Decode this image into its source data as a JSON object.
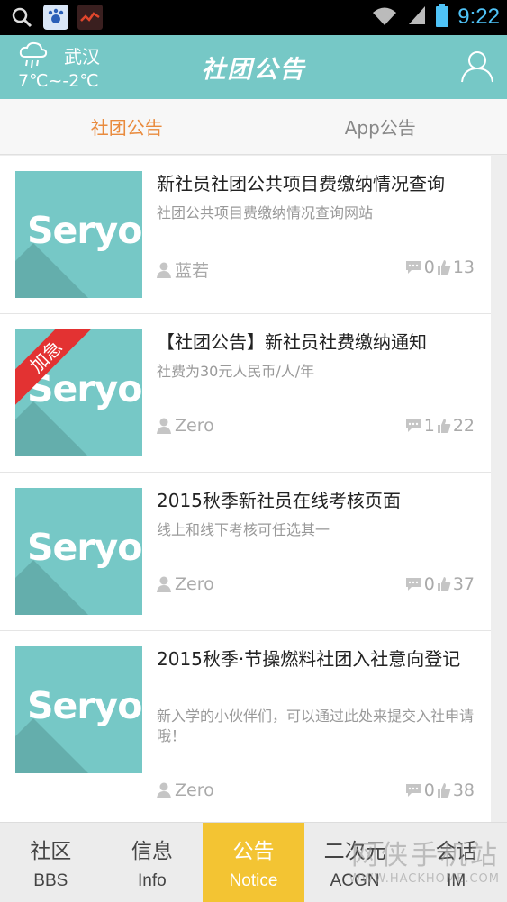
{
  "status_bar": {
    "time": "9:22"
  },
  "header": {
    "city": "武汉",
    "temperature": "7℃~-2℃",
    "title": "社团公告"
  },
  "tabs": [
    {
      "label": "社团公告",
      "active": true
    },
    {
      "label": "App公告",
      "active": false
    }
  ],
  "thumbnail_text": "Seryo.",
  "posts": [
    {
      "title": "新社员社团公共项目费缴纳情况查询",
      "desc": "社团公共项目费缴纳情况查询网站",
      "author": "蓝若",
      "comments": "0",
      "likes": "13",
      "urgent": ""
    },
    {
      "title": "【社团公告】新社员社费缴纳通知",
      "desc": "社费为30元人民币/人/年",
      "author": "Zero",
      "comments": "1",
      "likes": "22",
      "urgent": "加急"
    },
    {
      "title": "2015秋季新社员在线考核页面",
      "desc": "线上和线下考核可任选其一",
      "author": "Zero",
      "comments": "0",
      "likes": "37",
      "urgent": ""
    },
    {
      "title": "2015秋季·节操燃料社团入社意向登记",
      "desc": "新入学的小伙伴们，可以通过此处来提交入社申请哦！",
      "author": "Zero",
      "comments": "0",
      "likes": "38",
      "urgent": ""
    }
  ],
  "bottom_nav": [
    {
      "zh": "社区",
      "en": "BBS",
      "active": false
    },
    {
      "zh": "信息",
      "en": "Info",
      "active": false
    },
    {
      "zh": "公告",
      "en": "Notice",
      "active": true
    },
    {
      "zh": "二次元",
      "en": "ACGN",
      "active": false
    },
    {
      "zh": "会话",
      "en": "IM",
      "active": false
    }
  ],
  "watermark": {
    "line1": "网侠手机站",
    "line2": "WWW.HACKHOME.COM"
  },
  "colors": {
    "header": "#76c8c6",
    "tab_active": "#e98b3e",
    "nav_active": "#f3c433",
    "urgent": "#e33232"
  }
}
